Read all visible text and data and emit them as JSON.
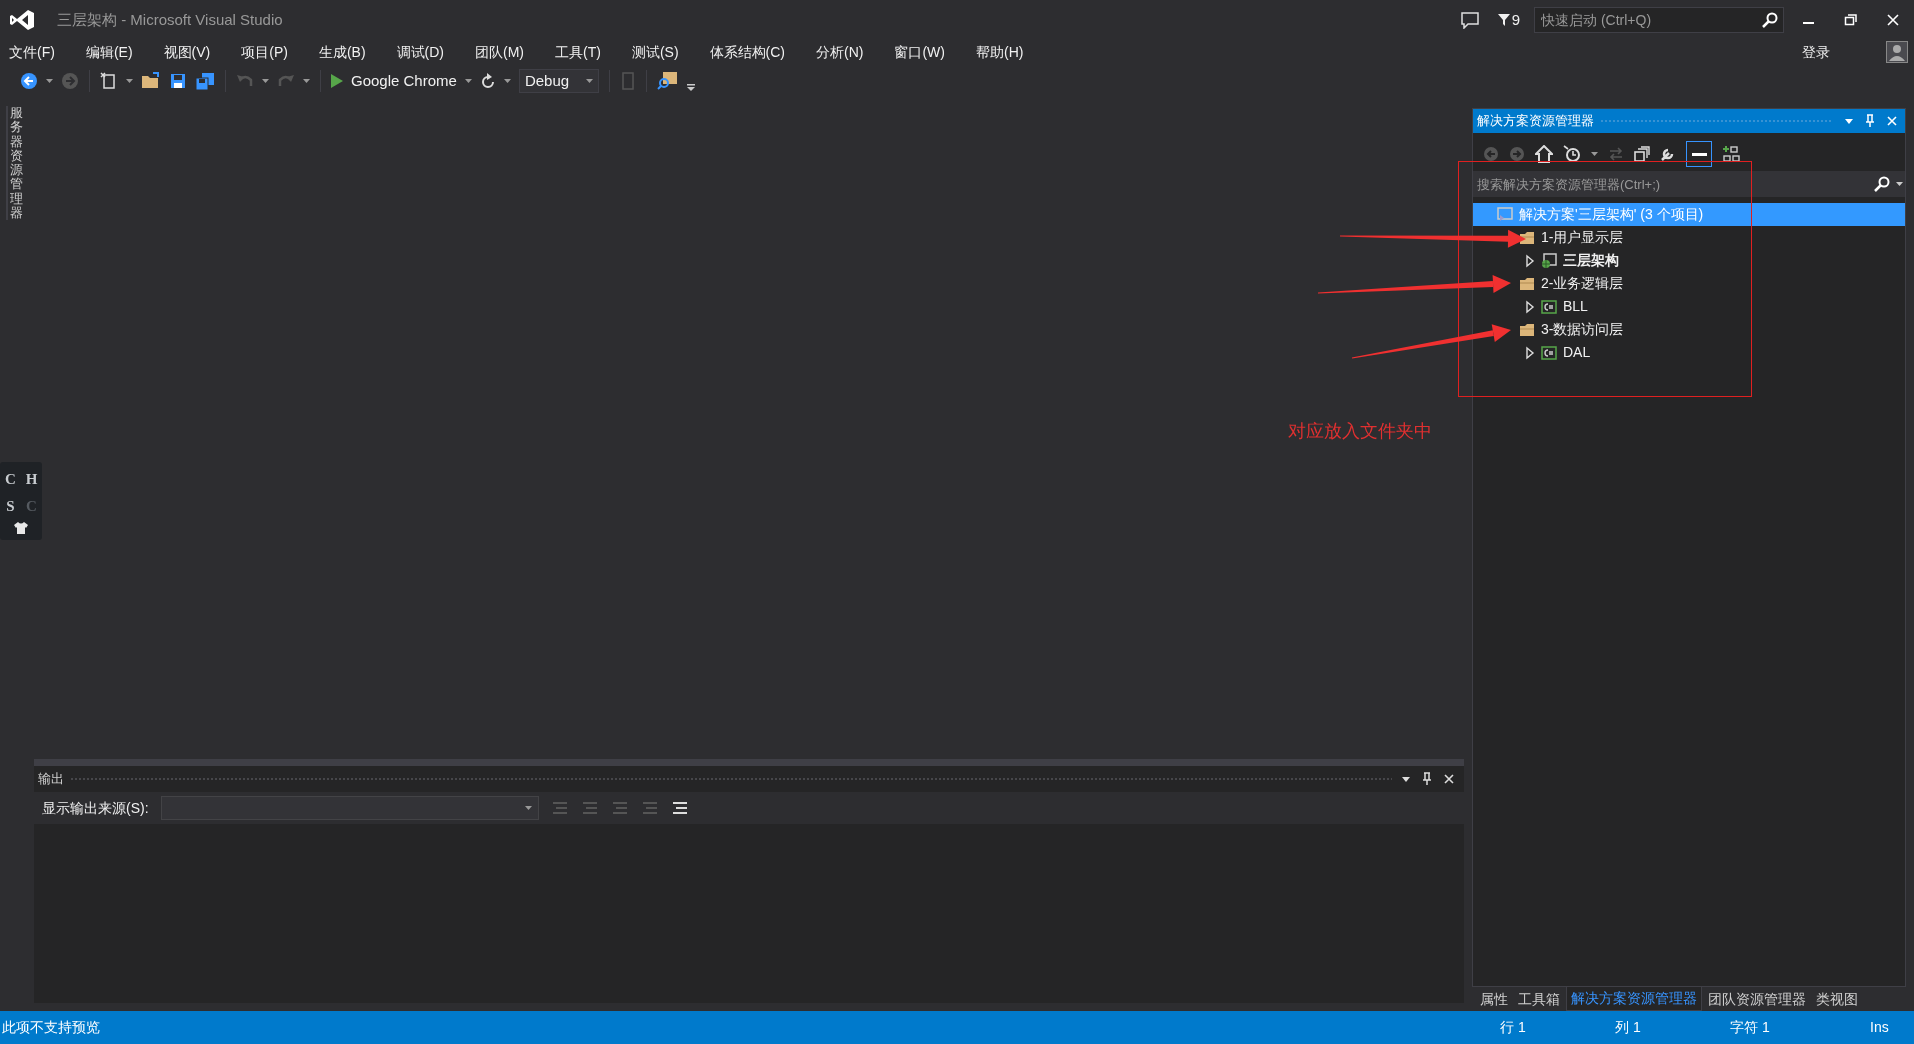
{
  "window": {
    "title": "三层架构 - Microsoft Visual Studio"
  },
  "title_bar": {
    "notification_count": "9",
    "quick_launch": {
      "placeholder": "快速启动 (Ctrl+Q)"
    },
    "sign_in": "登录"
  },
  "menu": [
    "文件(F)",
    "编辑(E)",
    "视图(V)",
    "项目(P)",
    "生成(B)",
    "调试(D)",
    "团队(M)",
    "工具(T)",
    "测试(S)",
    "体系结构(C)",
    "分析(N)",
    "窗口(W)",
    "帮助(H)"
  ],
  "toolbar": {
    "startup_target": "Google Chrome",
    "configuration": "Debug"
  },
  "side_tabs": [
    "服务器资源管理器"
  ],
  "ime_indicator": [
    {
      "char": "C",
      "dim": false
    },
    {
      "char": "H",
      "dim": false
    },
    {
      "char": "S",
      "dim": false
    },
    {
      "char": "C",
      "dim": true
    }
  ],
  "solution_explorer": {
    "title": "解决方案资源管理器",
    "search": {
      "placeholder": "搜索解决方案资源管理器(Ctrl+;)"
    },
    "tree": [
      {
        "label": "解决方案'三层架构' (3 个项目)",
        "kind": "solution",
        "selected": true,
        "children": [
          {
            "label": "1-用户显示层",
            "kind": "folder",
            "selected": false,
            "children": [
              {
                "label": "三层架构",
                "kind": "web",
                "selected": false,
                "startup": true,
                "expanded": false
              }
            ]
          },
          {
            "label": "2-业务逻辑层",
            "kind": "folder",
            "selected": false,
            "children": [
              {
                "label": "BLL",
                "kind": "csharp",
                "selected": false,
                "startup": false,
                "expanded": false
              }
            ]
          },
          {
            "label": "3-数据访问层",
            "kind": "folder",
            "selected": false,
            "children": [
              {
                "label": "DAL",
                "kind": "csharp",
                "selected": false,
                "startup": false,
                "expanded": false
              }
            ]
          }
        ]
      }
    ]
  },
  "annotation": {
    "text": "对应放入文件夹中"
  },
  "output": {
    "title": "输出",
    "source_label": "显示输出来源(S):"
  },
  "bottom_tabs": [
    {
      "label": "属性",
      "selected": false
    },
    {
      "label": "工具箱",
      "selected": false
    },
    {
      "label": "解决方案资源管理器",
      "selected": true
    },
    {
      "label": "团队资源管理器",
      "selected": false
    },
    {
      "label": "类视图",
      "selected": false
    }
  ],
  "status_bar": {
    "message": "此项不支持预览",
    "line": "行 1",
    "column": "列 1",
    "character": "字符 1",
    "mode": "Ins"
  }
}
